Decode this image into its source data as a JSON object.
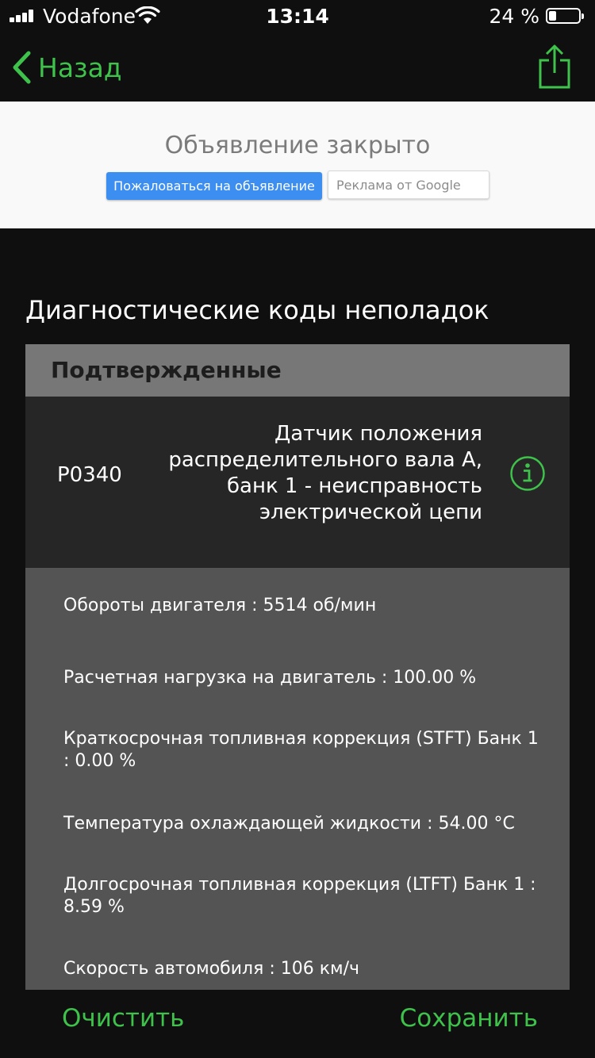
{
  "status": {
    "carrier": "Vodafone",
    "time": "13:14",
    "battery": "24 %"
  },
  "nav": {
    "back_label": "Назад",
    "share_icon": "share-icon"
  },
  "ad": {
    "title": "Объявление закрыто",
    "report_label": "Пожаловаться на объявление",
    "google_label": "Реклама от Google"
  },
  "section": {
    "title": "Диагностические коды неполадок"
  },
  "card": {
    "header": "Подтвержденные",
    "code": "P0340",
    "description": "Датчик положения распределительного вала A, банк 1 - неисправность электрической цепи",
    "params": [
      "Обороты двигателя : 5514 об/мин",
      "Расчетная нагрузка на двигатель : 100.00 %",
      "Краткосрочная топливная коррекция (STFT) Банк 1 : 0.00 %",
      "Температура охлаждающей жидкости : 54.00 °C",
      "Долгосрочная топливная коррекция (LTFT) Банк 1 : 8.59 %",
      "Скорость автомобиля : 106 км/ч"
    ]
  },
  "actions": {
    "clear_label": "Очистить",
    "save_label": "Сохранить"
  },
  "colors": {
    "accent": "#3ec24b",
    "background": "#0f0f0f",
    "card": "#545454",
    "card_header": "#777777",
    "code_row": "#262626",
    "ad_button": "#3c8ef0"
  }
}
